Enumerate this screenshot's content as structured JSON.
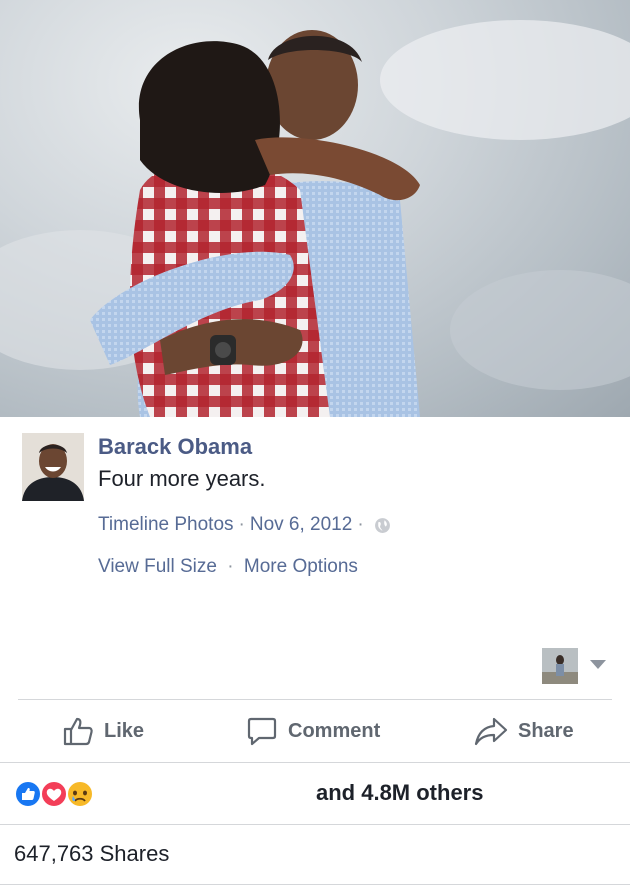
{
  "post": {
    "author": "Barack Obama",
    "caption": "Four more years.",
    "meta": {
      "album": "Timeline Photos",
      "separator": "·",
      "date": "Nov 6, 2012",
      "privacy_icon": "globe-icon"
    },
    "links": {
      "view_full_size": "View Full Size",
      "more_options": "More Options"
    }
  },
  "actions": {
    "like": "Like",
    "comment": "Comment",
    "share": "Share"
  },
  "reactions": {
    "icons": [
      "like-icon",
      "love-icon",
      "sad-icon"
    ],
    "summary": "and 4.8M others"
  },
  "shares": {
    "label": "647,763 Shares"
  },
  "colors": {
    "link": "#576b95",
    "author": "#4b5b85",
    "like_blue": "#1877f2",
    "love_red": "#f33e58",
    "sad_yellow": "#f7b928"
  }
}
